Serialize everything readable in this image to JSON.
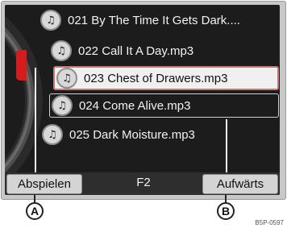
{
  "tracks": [
    {
      "label": "021 By The Time It Gets Dark....",
      "icon": "music-note-icon"
    },
    {
      "label": "022 Call It A Day.mp3",
      "icon": "music-note-icon"
    },
    {
      "label": "023 Chest of Drawers.mp3",
      "icon": "music-note-icon",
      "selected": true
    },
    {
      "label": "024 Come Alive.mp3",
      "icon": "music-note-icon"
    },
    {
      "label": "025 Dark Moisture.mp3",
      "icon": "music-note-icon"
    }
  ],
  "buttons": {
    "left": "Abspielen",
    "center": "F2",
    "right": "Aufwärts"
  },
  "callouts": {
    "a": "A",
    "b": "B"
  },
  "figure_code": "B5P-0597",
  "colors": {
    "scroll_indicator": "#d41c1c",
    "screen_background": "#1c1c1c",
    "selected_row": "#f0f0f0"
  }
}
